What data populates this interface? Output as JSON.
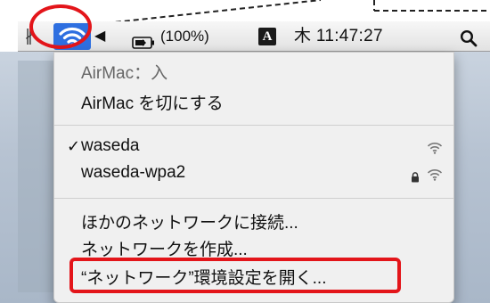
{
  "menubar": {
    "bluetooth_glyph": "∦",
    "volume_glyph": "◀",
    "battery_percent": "(100%)",
    "input_method": "A",
    "clock": "木 11:47:27",
    "icons": [
      "bluetooth-icon",
      "wifi-icon",
      "volume-icon",
      "battery-icon",
      "input-method-icon",
      "spotlight-search-icon"
    ]
  },
  "wifi_menu": {
    "status": "AirMac：入",
    "toggle": "AirMac を切にする",
    "networks": [
      {
        "name": "waseda",
        "selected": true,
        "secured": false,
        "check": "✓"
      },
      {
        "name": "waseda-wpa2",
        "selected": false,
        "secured": true,
        "check": ""
      }
    ],
    "join_other": "ほかのネットワークに接続...",
    "create_network": "ネットワークを作成...",
    "open_prefs": "“ネットワーク”環境設定を開く..."
  },
  "colors": {
    "highlight_blue": "#2e6fe0",
    "annotation_red": "#e3151a"
  }
}
